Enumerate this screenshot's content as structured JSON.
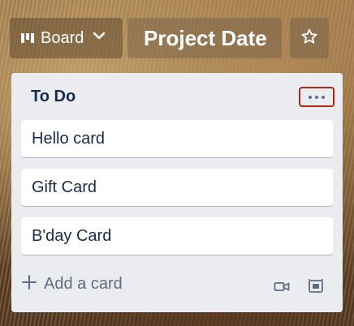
{
  "header": {
    "board_switcher_label": "Board",
    "board_title": "Project Date"
  },
  "list": {
    "title": "To Do",
    "cards": [
      {
        "label": "Hello card"
      },
      {
        "label": "Gift Card"
      },
      {
        "label": "B'day Card"
      }
    ],
    "add_card_label": "Add a card"
  },
  "icons": {
    "board_switcher": "board-icon",
    "chevron": "chevron-down-icon",
    "star": "star-icon",
    "list_menu": "more-icon",
    "video": "video-icon",
    "template": "template-icon"
  },
  "colors": {
    "list_background": "#ebecf0",
    "card_text": "#172b4d",
    "muted_text": "#5e6c84",
    "menu_highlight": "#b0281a"
  }
}
